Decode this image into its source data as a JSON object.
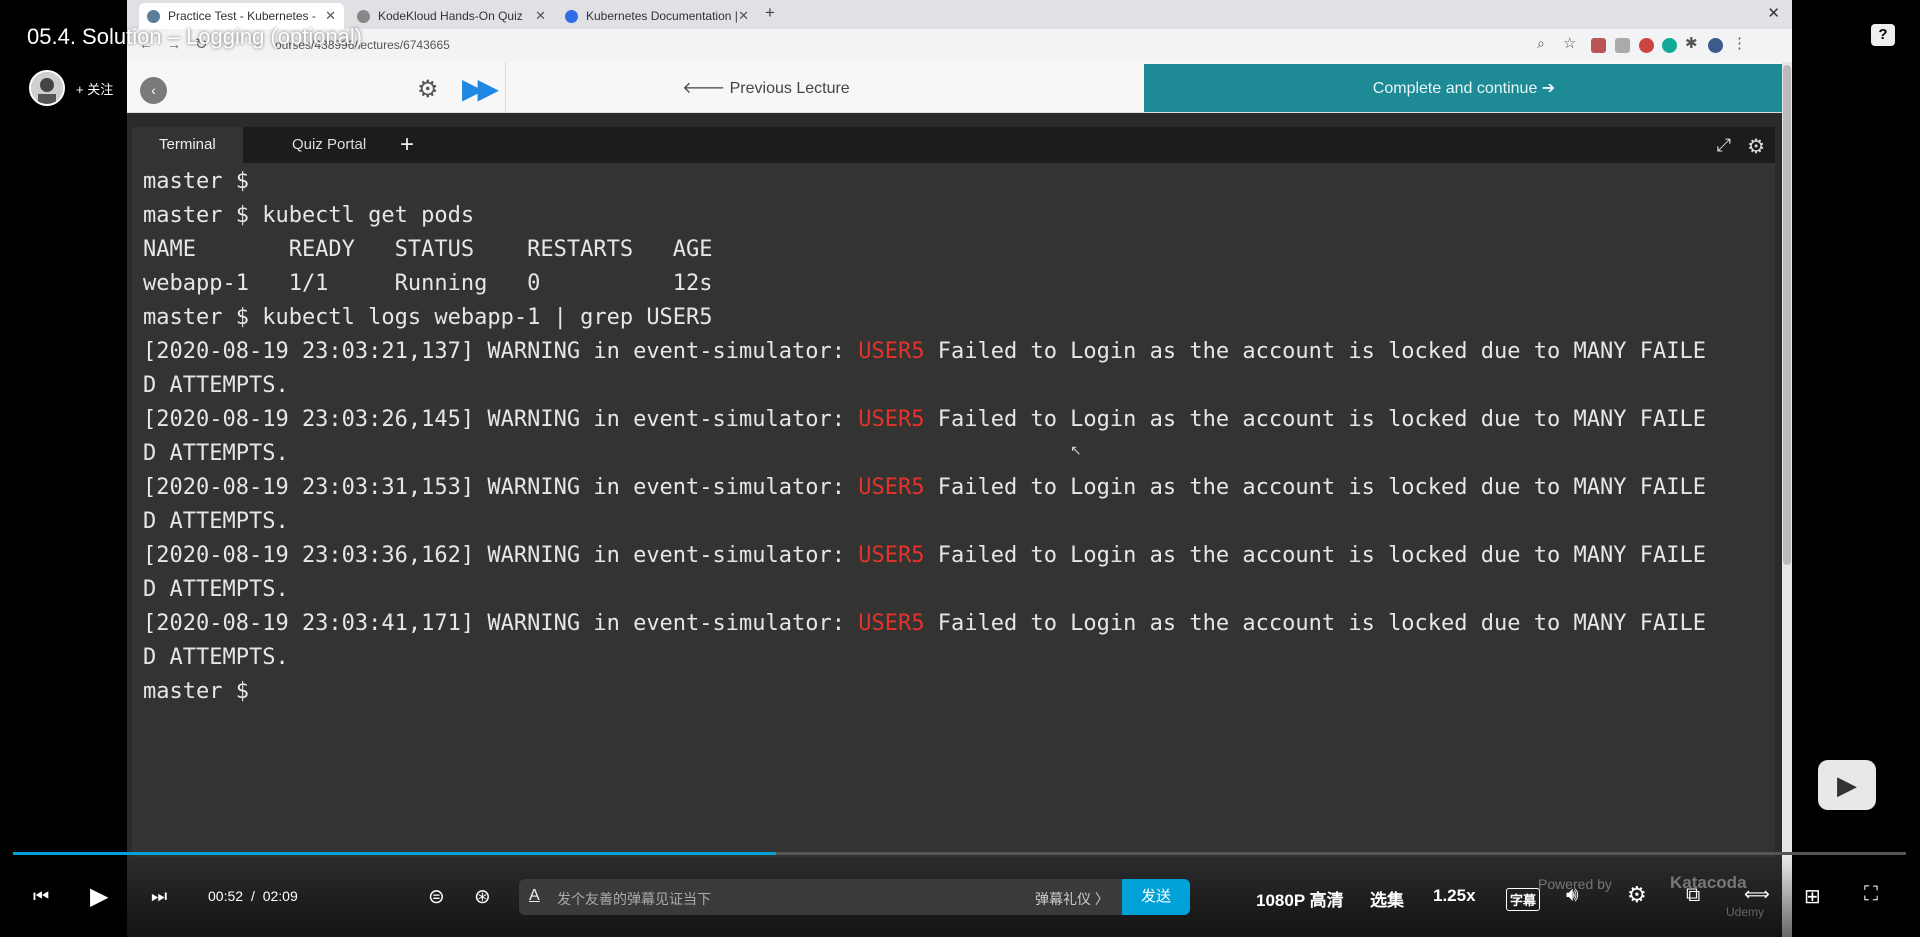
{
  "video": {
    "title": "05.4. Solution – Logging (optional)",
    "follow_label": "+ 关注"
  },
  "browser": {
    "tabs": [
      {
        "label": "Practice Test - Kubernetes - C",
        "active": true
      },
      {
        "label": "KodeKloud Hands-On Quiz",
        "active": false
      },
      {
        "label": "Kubernetes Documentation |",
        "active": false
      }
    ],
    "url": "ourses/438996/lectures/6743665"
  },
  "lecture_nav": {
    "prev_label": "🡐 Previous Lecture",
    "complete_label": "Complete and continue ➔"
  },
  "terminal": {
    "tabs": [
      "Terminal",
      "Quiz Portal"
    ],
    "lines": [
      {
        "text": "master $ "
      },
      {
        "text": "master $ kubectl get pods"
      },
      {
        "text": "NAME       READY   STATUS    RESTARTS   AGE"
      },
      {
        "text": "webapp-1   1/1     Running   0          12s"
      },
      {
        "text": "master $ kubectl logs webapp-1 | grep USER5"
      },
      {
        "pre": "[2020-08-19 23:03:21,137] WARNING in event-simulator: ",
        "hl": "USER5",
        "post": " Failed to Login as the account is locked due to MANY FAILE"
      },
      {
        "text": "D ATTEMPTS."
      },
      {
        "pre": "[2020-08-19 23:03:26,145] WARNING in event-simulator: ",
        "hl": "USER5",
        "post": " Failed to Login as the account is locked due to MANY FAILE"
      },
      {
        "text": "D ATTEMPTS."
      },
      {
        "pre": "[2020-08-19 23:03:31,153] WARNING in event-simulator: ",
        "hl": "USER5",
        "post": " Failed to Login as the account is locked due to MANY FAILE"
      },
      {
        "text": "D ATTEMPTS."
      },
      {
        "pre": "[2020-08-19 23:03:36,162] WARNING in event-simulator: ",
        "hl": "USER5",
        "post": " Failed to Login as the account is locked due to MANY FAILE"
      },
      {
        "text": "D ATTEMPTS."
      },
      {
        "pre": "[2020-08-19 23:03:41,171] WARNING in event-simulator: ",
        "hl": "USER5",
        "post": " Failed to Login as the account is locked due to MANY FAILE"
      },
      {
        "text": "D ATTEMPTS."
      },
      {
        "text": "master $ "
      }
    ],
    "highlight_color": "#e5322d"
  },
  "player": {
    "current_time": "00:52",
    "separator": "/",
    "duration": "02:09",
    "progress_fraction": 0.403,
    "danmaku_placeholder": "发个友善的弹幕见证当下",
    "danmaku_etiquette": "弹幕礼仪 〉",
    "send_label": "发送",
    "quality": "1080P 高清",
    "episodes": "选集",
    "speed": "1.25x",
    "subtitle": "字幕",
    "accent": "#00a1d6"
  },
  "watermark": {
    "powered_by": "Powered by",
    "brand": "Katacoda",
    "udemy": "Udemy"
  }
}
